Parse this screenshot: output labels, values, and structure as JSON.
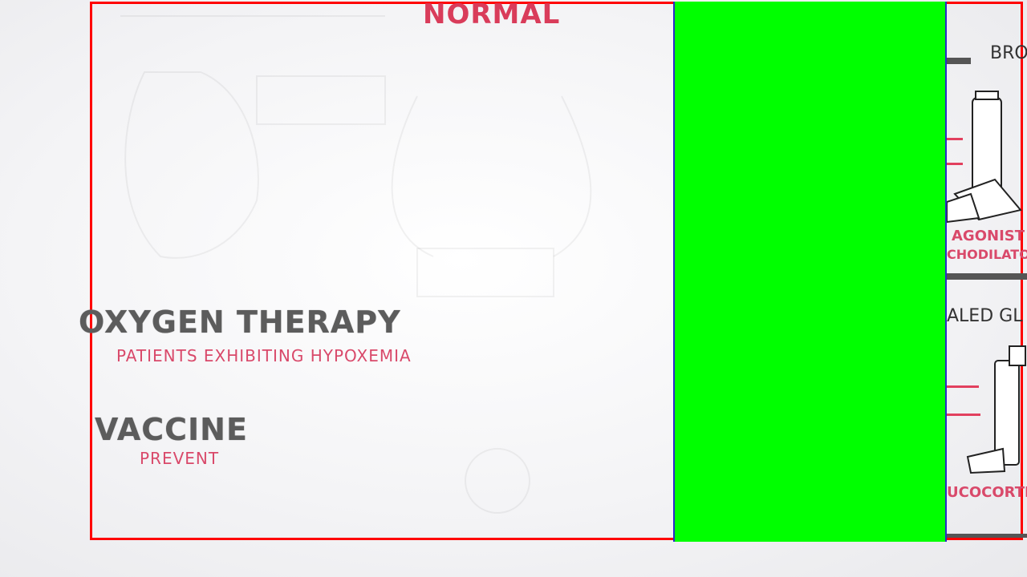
{
  "title": "NORMAL",
  "sections": [
    {
      "heading": "OXYGEN THERAPY",
      "sub": "PATIENTS EXHIBITING HYPOXEMIA"
    },
    {
      "heading": "VACCINE",
      "sub": "PREVENT"
    }
  ],
  "right_panel": {
    "top": "BRO",
    "agonist": "AGONIST",
    "broncho": "CHODILATO",
    "inhaled": "ALED GL",
    "gluco": "UCOCORTI"
  },
  "colors": {
    "border": "#ff0000",
    "green": "#00ff00",
    "accent": "#d93c5a"
  }
}
